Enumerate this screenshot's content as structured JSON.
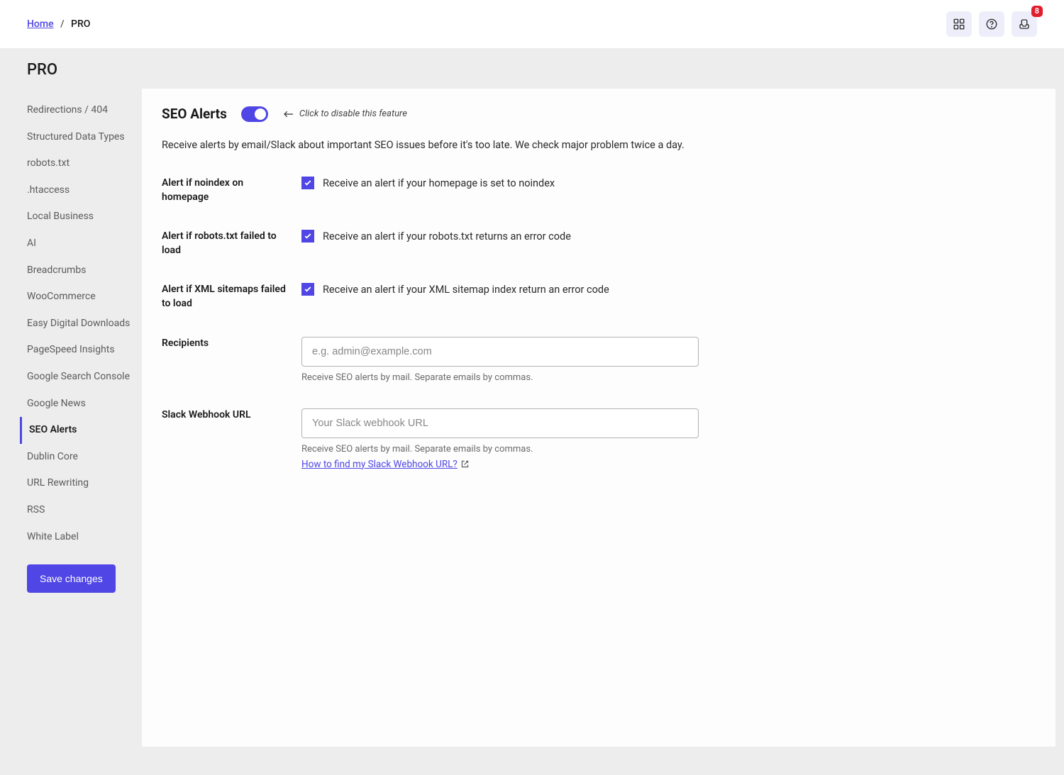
{
  "breadcrumb": {
    "home": "Home",
    "current": "PRO"
  },
  "notifications_count": "8",
  "page_title": "PRO",
  "sidebar": {
    "items": [
      "Redirections / 404",
      "Structured Data Types",
      "robots.txt",
      ".htaccess",
      "Local Business",
      "AI",
      "Breadcrumbs",
      "WooCommerce",
      "Easy Digital Downloads",
      "PageSpeed Insights",
      "Google Search Console",
      "Google News",
      "SEO Alerts",
      "Dublin Core",
      "URL Rewriting",
      "RSS",
      "White Label"
    ],
    "save_label": "Save changes"
  },
  "content": {
    "title": "SEO Alerts",
    "toggle_hint": "Click to disable this feature",
    "description": "Receive alerts by email/Slack about important SEO issues before it's too late. We check major problem twice a day.",
    "fields": {
      "noindex": {
        "label": "Alert if noindex on homepage",
        "check_label": "Receive an alert if your homepage is set to noindex"
      },
      "robots": {
        "label": "Alert if robots.txt failed to load",
        "check_label": "Receive an alert if your robots.txt returns an error code"
      },
      "sitemap": {
        "label": "Alert if XML sitemaps failed to load",
        "check_label": "Receive an alert if your XML sitemap index return an error code"
      },
      "recipients": {
        "label": "Recipients",
        "placeholder": "e.g. admin@example.com",
        "help": "Receive SEO alerts by mail. Separate emails by commas."
      },
      "slack": {
        "label": "Slack Webhook URL",
        "placeholder": "Your Slack webhook URL",
        "help": "Receive SEO alerts by mail. Separate emails by commas.",
        "link_text": "How to find my Slack Webhook URL?"
      }
    }
  }
}
